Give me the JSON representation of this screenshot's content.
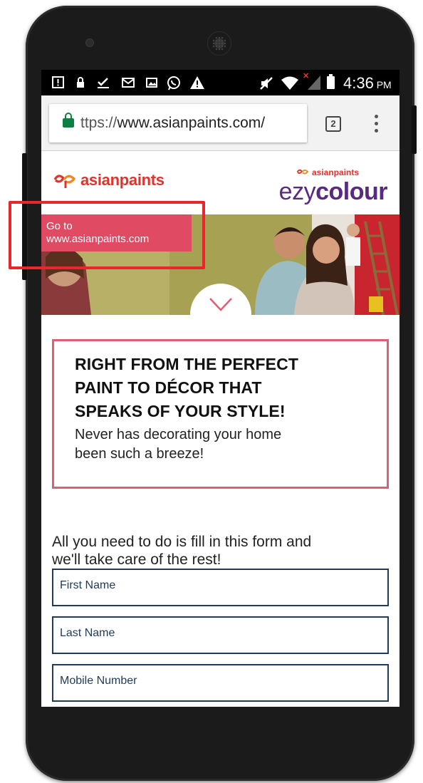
{
  "device": {
    "frame": "android-phone"
  },
  "statusbar": {
    "left_icons": [
      "alert-icon",
      "lock-icon",
      "download-done-icon",
      "gmail-icon",
      "image-icon",
      "whatsapp-icon",
      "warning-icon"
    ],
    "right_icons": [
      "mute-icon",
      "wifi-icon",
      "signal-icon",
      "battery-icon"
    ],
    "time": "4:36",
    "ampm": "PM"
  },
  "browser": {
    "url": "https://www.asianpaints.com/",
    "url_display_prefix": "ttps://",
    "url_display_host": "www.asianpaints.com/",
    "tab_count": "2",
    "secure_color": "#0b8043"
  },
  "header": {
    "brand_logo_text": "asianpaints",
    "ezy_logo_top": "asianpaints",
    "ezy_logo_main_light": "ezy",
    "ezy_logo_main_bold": "colour",
    "brand_color": "#e1332d",
    "ezy_color": "#5a2a82"
  },
  "banner": {
    "goto_line1": "Go to",
    "goto_line2": "www.asianpaints.com",
    "goto_color": "#e04a62"
  },
  "promo": {
    "title_line1": "RIGHT FROM THE PERFECT",
    "title_line2": "PAINT TO DÉCOR THAT",
    "title_line3": "SPEAKS OF YOUR STYLE!",
    "sub_line1": "Never has decorating your home",
    "sub_line2": "been such a breeze!",
    "border_color": "#e05e74"
  },
  "form": {
    "intro_line1": "All you need to do is fill in this form and",
    "intro_line2": "we'll take care of the rest!",
    "fields": [
      {
        "placeholder": "First Name"
      },
      {
        "placeholder": "Last Name"
      },
      {
        "placeholder": "Mobile Number"
      }
    ],
    "field_color": "#1f3a5a"
  },
  "annotation": {
    "color": "#e8262b"
  }
}
